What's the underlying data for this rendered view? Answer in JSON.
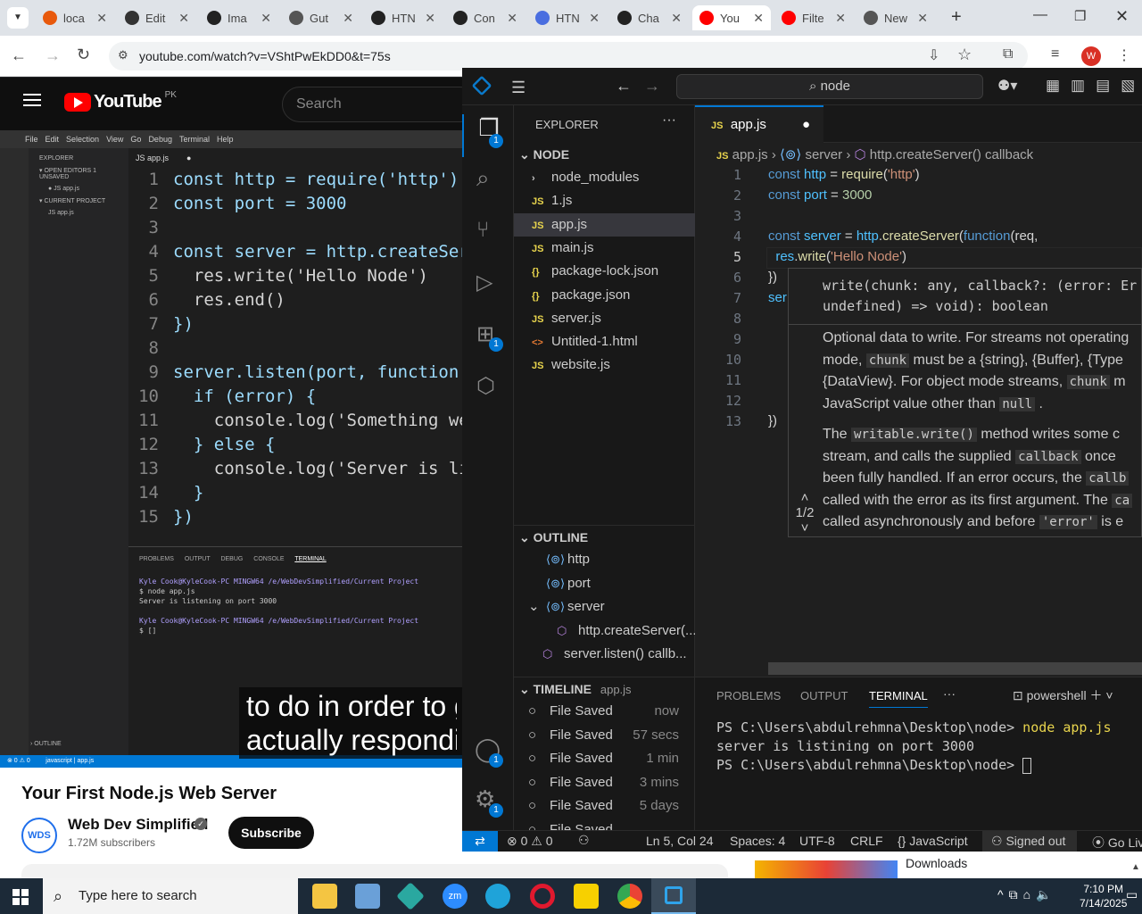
{
  "chrome": {
    "tabs": [
      {
        "label": "loca"
      },
      {
        "label": "Edit"
      },
      {
        "label": "Ima"
      },
      {
        "label": "Gut"
      },
      {
        "label": "HTN"
      },
      {
        "label": "Con"
      },
      {
        "label": "HTN"
      },
      {
        "label": "Cha"
      },
      {
        "label": "You"
      },
      {
        "label": "Filte"
      },
      {
        "label": "New"
      }
    ],
    "url": "youtube.com/watch?v=VShtPwEkDD0&t=75s",
    "profile_initial": "W"
  },
  "youtube": {
    "logo": "YouTube",
    "region": "PK",
    "search_placeholder": "Search",
    "video_title": "Your First Node.js Web Server",
    "channel": "Web Dev Simplified",
    "subscribers": "1.72M subscribers",
    "subscribe": "Subscribe",
    "caption_line1": "to do in order to g",
    "caption_line2": "actually respondi",
    "downloads": "Downloads",
    "video_code": [
      {
        "n": "1",
        "text": "const http = require('http')"
      },
      {
        "n": "2",
        "text": "const port = 3000"
      },
      {
        "n": "3",
        "text": ""
      },
      {
        "n": "4",
        "text": "const server = http.createServ"
      },
      {
        "n": "5",
        "text": "  res.write('Hello Node')"
      },
      {
        "n": "6",
        "text": "  res.end()"
      },
      {
        "n": "7",
        "text": "})"
      },
      {
        "n": "8",
        "text": ""
      },
      {
        "n": "9",
        "text": "server.listen(port, function(e"
      },
      {
        "n": "10",
        "text": "  if (error) {"
      },
      {
        "n": "11",
        "text": "    console.log('Something wen"
      },
      {
        "n": "12",
        "text": "  } else {"
      },
      {
        "n": "13",
        "text": "    console.log('Server is lis"
      },
      {
        "n": "14",
        "text": "  }"
      },
      {
        "n": "15",
        "text": "})"
      }
    ],
    "video_menu": [
      "File",
      "Edit",
      "Selection",
      "View",
      "Go",
      "Debug",
      "Terminal",
      "Help"
    ],
    "video_term": [
      "Kyle Cook@KyleCook-PC MINGW64 /e/WebDevSimplified/Current Project",
      "$ node app.js",
      "Server is listening on port 3000",
      "",
      "Kyle Cook@KyleCook-PC MINGW64 /e/WebDevSimplified/Current Project",
      "$ []"
    ]
  },
  "vscode": {
    "search": "node",
    "explorer_title": "EXPLORER",
    "folder": "NODE",
    "files": [
      "node_modules",
      "1.js",
      "app.js",
      "main.js",
      "package-lock.json",
      "package.json",
      "server.js",
      "Untitled-1.html",
      "website.js"
    ],
    "outline_title": "OUTLINE",
    "outline": [
      "http",
      "port",
      "server",
      "http.createServer(...",
      "server.listen() callb..."
    ],
    "timeline_title": "TIMELINE",
    "timeline_file": "app.js",
    "timeline": [
      {
        "label": "File Saved",
        "when": "now"
      },
      {
        "label": "File Saved",
        "when": "57 secs"
      },
      {
        "label": "File Saved",
        "when": "1 min"
      },
      {
        "label": "File Saved",
        "when": "3 mins"
      },
      {
        "label": "File Saved",
        "when": "5 days"
      },
      {
        "label": "File Saved",
        "when": ""
      }
    ],
    "tab": "app.js",
    "breadcrumb": [
      "app.js",
      "server",
      "http.createServer() callback"
    ],
    "code_lines": [
      "1",
      "2",
      "3",
      "4",
      "5",
      "6",
      "7",
      "8",
      "9",
      "10",
      "11",
      "12",
      "13"
    ],
    "hover_sig1": "write(chunk: any, callback?: (error: Er",
    "hover_sig2": "undefined) => void): boolean",
    "hover_p1": [
      "Optional data to write. For streams not operating",
      "mode,",
      "chunk",
      "must be a {string}, {Buffer}, {Type",
      "{DataView}. For object mode streams,",
      "chunk",
      "m",
      "JavaScript value other than",
      "null",
      "."
    ],
    "hover_p2_line1": "The",
    "hover_p2_code1": "writable.write()",
    "hover_p2_rest1": "method writes some c",
    "hover_p2_line2": "stream, and calls the supplied",
    "hover_p2_code2": "callback",
    "hover_p2_rest2": "once",
    "hover_p2_line3": "been fully handled. If an error occurs, the",
    "hover_p2_code3": "callb",
    "hover_p2_line4": "called with the error as its first argument. The",
    "hover_p2_code4": "ca",
    "hover_p2_line5": "called asynchronously and before",
    "hover_p2_code5": "'error'",
    "hover_p2_rest5": "is e",
    "hover_pager": "1/2",
    "panel_tabs": [
      "PROBLEMS",
      "OUTPUT",
      "TERMINAL"
    ],
    "shell": "powershell",
    "terminal": [
      {
        "prompt": "PS C:\\Users\\abdulrehmna\\Desktop\\node>",
        "cmd": "node app.js"
      },
      {
        "prompt": "server is listining on port 3000",
        "cmd": ""
      },
      {
        "prompt": "PS C:\\Users\\abdulrehmna\\Desktop\\node>",
        "cmd": ""
      }
    ],
    "status": {
      "errors": "0",
      "warnings": "0",
      "position": "Ln 5, Col 24",
      "spaces": "Spaces: 4",
      "encoding": "UTF-8",
      "eol": "CRLF",
      "lang": "JavaScript",
      "signed": "Signed out",
      "golive": "Go Liv"
    },
    "badge": "1"
  },
  "taskbar": {
    "search": "Type here to search",
    "time": "7:10 PM",
    "date": "7/14/2025"
  },
  "colors": {
    "accent": "#0078d4",
    "yt_red": "#ff0000",
    "vs_blue": "#0078d4"
  }
}
